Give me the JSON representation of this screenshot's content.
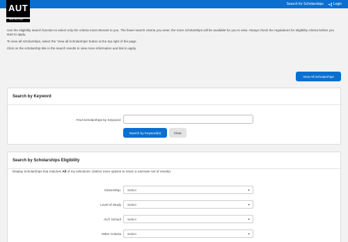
{
  "topbar": {
    "search_label": "Search for Scholarships",
    "login_label": "Login"
  },
  "logo": {
    "text": "AUT",
    "subtext": "NEW ZEALAND"
  },
  "intro": {
    "p1": "Use the eligibility search function to select only the criteria most relevant to you.  The fewer search criteria you enter, the more scholarships will be available for you to view.  Always check the regulations for eligibility criteria before you start to apply.",
    "p2": "To view all scholarships, select the 'View all Scholarships' button at the top right of the page.",
    "p3": "Click on the scholarship title in the search results to view more information and link to apply."
  },
  "view_all_label": "View All Scholarships",
  "keyword_panel": {
    "title": "Search by Keyword",
    "field_label": "Find Scholarships by Keyword:",
    "input_value": "",
    "search_button": "Search by Keyword(s)",
    "clear_button": "Clear"
  },
  "eligibility_panel": {
    "title": "Search by Scholarships Eligibility",
    "note_before": "Display Scholarships that matches ",
    "note_bold": "All",
    "note_after": " of my selections: (Select more options to return a narrower set of results).",
    "filters": [
      {
        "label": "Citizenship:",
        "value": "Select"
      },
      {
        "label": "Level of Study",
        "value": "Select"
      },
      {
        "label": "AUT School",
        "value": "Select"
      },
      {
        "label": "Other Criteria",
        "value": "Select"
      }
    ]
  }
}
